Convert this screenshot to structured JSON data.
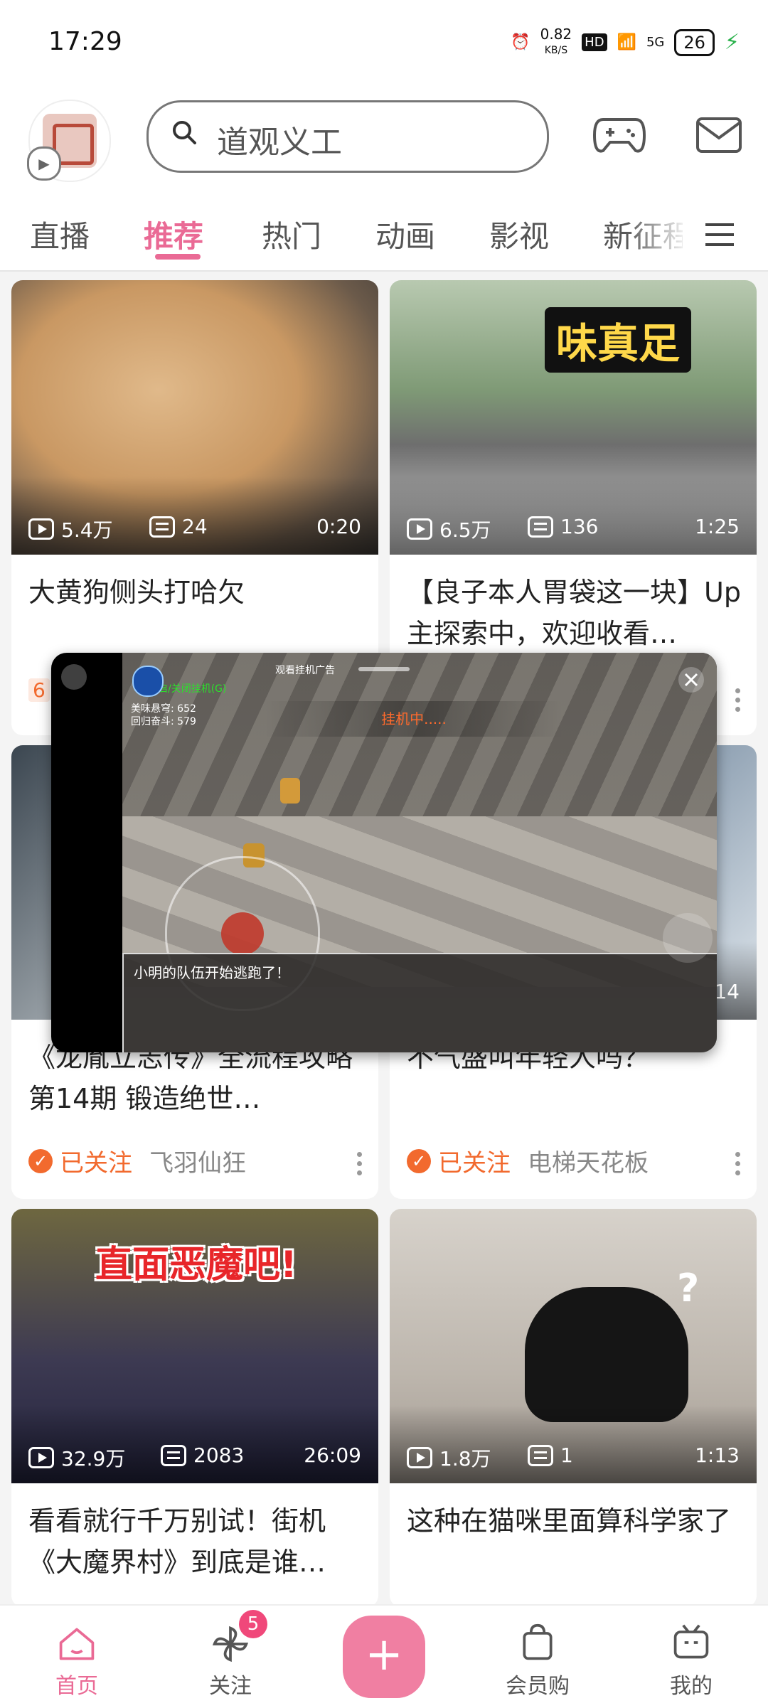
{
  "status_bar": {
    "time": "17:29",
    "speed": "0.82",
    "speed_unit": "KB/S",
    "hd": "HD",
    "network": "5G",
    "battery": "26"
  },
  "header": {
    "search_placeholder": "道观义工",
    "avatar_badge_icon": "play-icon"
  },
  "tabs": [
    {
      "label": "直播",
      "active": false
    },
    {
      "label": "推荐",
      "active": true
    },
    {
      "label": "热门",
      "active": false
    },
    {
      "label": "动画",
      "active": false
    },
    {
      "label": "影视",
      "active": false
    },
    {
      "label": "新征程",
      "active": false
    }
  ],
  "cards": [
    {
      "views": "5.4万",
      "comments": "24",
      "duration": "0:20",
      "title": "大黄狗侧头打哈欠",
      "partial_tag": "6"
    },
    {
      "views": "6.5万",
      "comments": "136",
      "duration": "1:25",
      "title": "【良子本人胃袋这一块】Up主探索中，欢迎收看…",
      "thumb_caption": "味真足"
    },
    {
      "duration": "14",
      "title": "《龙胤立志传》全流程攻略 第14期 锻造绝世…",
      "followed_label": "已关注",
      "author": "飞羽仙狂"
    },
    {
      "title": "不气盛叫年轻人吗？",
      "followed_label": "已关注",
      "author": "电梯天花板"
    },
    {
      "views": "32.9万",
      "comments": "2083",
      "duration": "26:09",
      "title": "看看就行千万别试！街机《大魔界村》到底是谁…",
      "thumb_caption": "直面恶魔吧!"
    },
    {
      "views": "1.8万",
      "comments": "1",
      "duration": "1:13",
      "title": "这种在猫咪里面算科学家了",
      "thumb_caption": "?"
    }
  ],
  "floating_window": {
    "hud_top": "开启/关闭挂机(G)",
    "hud_stats": [
      "美味悬穹: 652",
      "回归奋斗: 579"
    ],
    "ad_label": "观看挂机广告",
    "idle_text": "挂机中.....",
    "dialog_text": "小明的队伍开始逃跑了！"
  },
  "bottom_nav": [
    {
      "label": "首页",
      "icon": "home-icon",
      "active": true
    },
    {
      "label": "关注",
      "icon": "pinwheel-icon",
      "active": false,
      "badge": "5"
    },
    {
      "label": "",
      "icon": "plus-icon",
      "active": false
    },
    {
      "label": "会员购",
      "icon": "shopping-bag-icon",
      "active": false
    },
    {
      "label": "我的",
      "icon": "tv-icon",
      "active": false
    }
  ],
  "colors": {
    "accent": "#ea6a95",
    "follow": "#f26a2e"
  }
}
